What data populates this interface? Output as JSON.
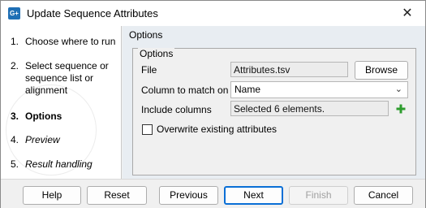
{
  "window": {
    "title": "Update Sequence Attributes",
    "app_icon_text": "G+",
    "close_symbol": "✕"
  },
  "steps": [
    {
      "num": "1.",
      "label": "Choose where to run",
      "style": "normal"
    },
    {
      "num": "2.",
      "label": "Select sequence or sequence list or alignment",
      "style": "normal"
    },
    {
      "num": "3.",
      "label": "Options",
      "style": "bold"
    },
    {
      "num": "4.",
      "label": "Preview",
      "style": "italic"
    },
    {
      "num": "5.",
      "label": "Result handling",
      "style": "italic"
    }
  ],
  "main": {
    "title": "Options",
    "group_title": "Options",
    "file": {
      "label": "File",
      "value": "Attributes.tsv",
      "browse_label": "Browse"
    },
    "column": {
      "label": "Column to match on",
      "selected": "Name",
      "chevron": "⌄"
    },
    "include": {
      "label": "Include columns",
      "value": "Selected 6 elements.",
      "add_icon": "plus-icon"
    },
    "overwrite": {
      "label": "Overwrite existing attributes",
      "checked": false
    }
  },
  "footer": {
    "help": "Help",
    "reset": "Reset",
    "previous": "Previous",
    "next": "Next",
    "finish": "Finish",
    "cancel": "Cancel"
  },
  "colors": {
    "accent": "#0a6fd6",
    "plus": "#2e9d2e",
    "panel": "#e8edf2"
  }
}
